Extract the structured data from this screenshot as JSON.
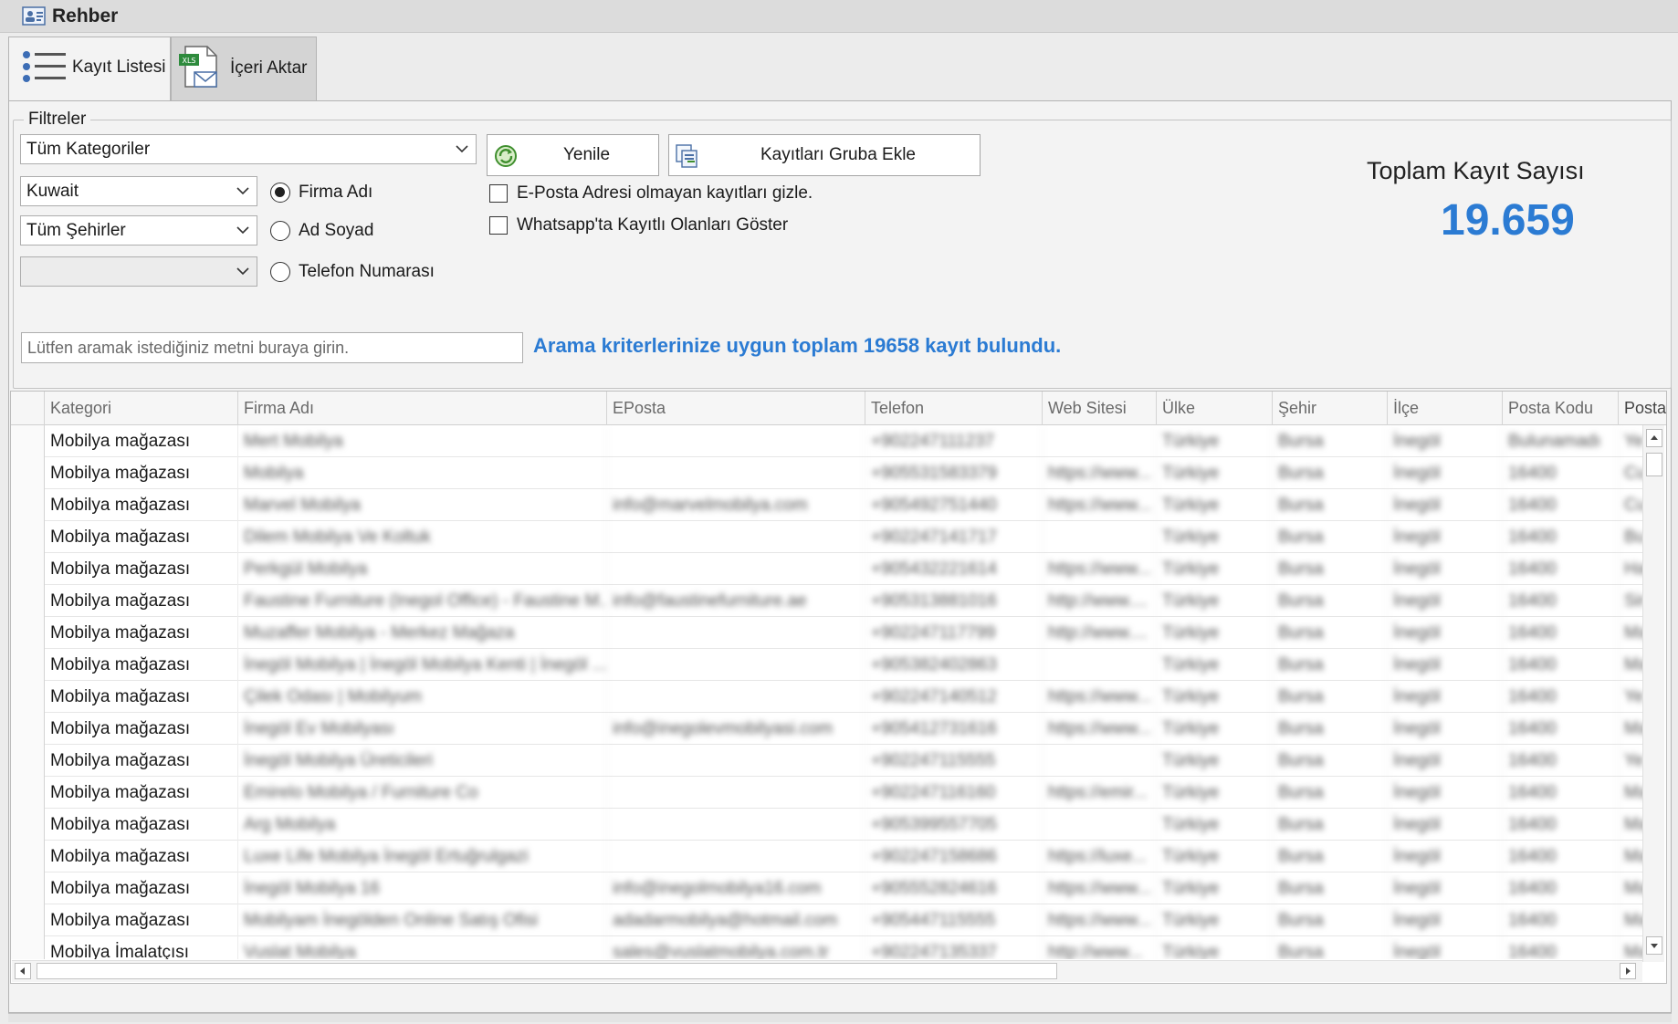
{
  "window": {
    "title": "Rehber"
  },
  "tabs": [
    {
      "label": "Kayıt Listesi",
      "icon": "list-icon",
      "active": true
    },
    {
      "label": "İçeri Aktar",
      "icon": "xls-import-icon",
      "active": false
    }
  ],
  "filters": {
    "legend": "Filtreler",
    "category": "Tüm Kategoriler",
    "country": "Kuwait",
    "city": "Tüm Şehirler",
    "district": "",
    "search_mode": {
      "options": [
        "Firma Adı",
        "Ad Soyad",
        "Telefon Numarası"
      ],
      "selected": "Firma Adı"
    },
    "refresh_label": "Yenile",
    "add_group_label": "Kayıtları Gruba Ekle",
    "hide_no_email_label": "E-Posta Adresi olmayan kayıtları gizle.",
    "show_whatsapp_label": "Whatsapp'ta Kayıtlı Olanları Göster",
    "hide_no_email_checked": false,
    "show_whatsapp_checked": false
  },
  "summary": {
    "total_label": "Toplam Kayıt Sayısı",
    "total_value": "19.659"
  },
  "search": {
    "placeholder": "Lütfen aramak istediğiniz metni buraya girin.",
    "value": ""
  },
  "result_message": "Arama kriterlerinize uygun toplam 19658 kayıt bulundu.",
  "colors": {
    "accent": "#2b7bd3"
  },
  "grid": {
    "columns": [
      "Kategori",
      "Firma Adı",
      "EPosta",
      "Telefon",
      "Web Sitesi",
      "Ülke",
      "Şehir",
      "İlçe",
      "Posta Kodu",
      "Posta"
    ],
    "rows": [
      [
        "Mobilya mağazası",
        "Mert Mobilya",
        "",
        "+902247111237",
        "",
        "Türkiye",
        "Bursa",
        "İnegöl",
        "Bulunamadı",
        "Ye"
      ],
      [
        "Mobilya mağazası",
        "Mobilya",
        "",
        "+905531583379",
        "https://www...",
        "Türkiye",
        "Bursa",
        "İnegöl",
        "16400",
        "Cu"
      ],
      [
        "Mobilya mağazası",
        "Marvel Mobilya",
        "info@marvelmobilya.com",
        "+905492751440",
        "https://www...",
        "Türkiye",
        "Bursa",
        "İnegöl",
        "16400",
        "Cu"
      ],
      [
        "Mobilya mağazası",
        "Dilem Mobilya Ve Koltuk",
        "",
        "+902247141717",
        "",
        "Türkiye",
        "Bursa",
        "İnegöl",
        "16400",
        "Bu"
      ],
      [
        "Mobilya mağazası",
        "Perkgül Mobilya",
        "",
        "+905432221614",
        "https://www...",
        "Türkiye",
        "Bursa",
        "İnegöl",
        "16400",
        "Ha"
      ],
      [
        "Mobilya mağazası",
        "Faustine Furniture (Inegol Office) - Faustine M...",
        "info@faustinefurniture.ae",
        "+905313881016",
        "http://www....",
        "Türkiye",
        "Bursa",
        "İnegöl",
        "16400",
        "Sir"
      ],
      [
        "Mobilya mağazası",
        "Muzaffer Mobilya - Merkez Mağaza",
        "",
        "+902247117799",
        "http://www....",
        "Türkiye",
        "Bursa",
        "İnegöl",
        "16400",
        "Ma"
      ],
      [
        "Mobilya mağazası",
        "İnegöl Mobilya | İnegöl Mobilya Kenti | İnegöl ...",
        "",
        "+905382402863",
        "",
        "Türkiye",
        "Bursa",
        "İnegöl",
        "16400",
        "Ma"
      ],
      [
        "Mobilya mağazası",
        "Çilek Odası | Mobilyum",
        "",
        "+902247140512",
        "https://www...",
        "Türkiye",
        "Bursa",
        "İnegöl",
        "16400",
        "Ye"
      ],
      [
        "Mobilya mağazası",
        "İnegöl Ev Mobilyası",
        "info@inegolevmobilyasi.com",
        "+905412731616",
        "https://www...",
        "Türkiye",
        "Bursa",
        "İnegöl",
        "16400",
        "Ma"
      ],
      [
        "Mobilya mağazası",
        "İnegöl Mobilya Üreticileri",
        "",
        "+902247115555",
        "",
        "Türkiye",
        "Bursa",
        "İnegöl",
        "16400",
        "Ye"
      ],
      [
        "Mobilya mağazası",
        "Emirelo Mobilya / Furniture Co",
        "",
        "+902247116160",
        "https://emir...",
        "Türkiye",
        "Bursa",
        "İnegöl",
        "16400",
        "Ma"
      ],
      [
        "Mobilya mağazası",
        "Arg Mobilya",
        "",
        "+905399557705",
        "",
        "Türkiye",
        "Bursa",
        "İnegöl",
        "16400",
        "Ma"
      ],
      [
        "Mobilya mağazası",
        "Luxe Life Mobilya İnegöl Ertuğrulgazi",
        "",
        "+902247158686",
        "https://luxe...",
        "Türkiye",
        "Bursa",
        "İnegöl",
        "16400",
        "Ma"
      ],
      [
        "Mobilya mağazası",
        "İnegöl Mobilya 16",
        "info@inegolmobilya16.com",
        "+905552824616",
        "https://www...",
        "Türkiye",
        "Bursa",
        "İnegöl",
        "16400",
        "Ma"
      ],
      [
        "Mobilya mağazası",
        "Mobilyam İnegölden Online Satış Ofisi",
        "adadarmobilya@hotmail.com",
        "+905447115555",
        "https://www...",
        "Türkiye",
        "Bursa",
        "İnegöl",
        "16400",
        "Ma"
      ],
      [
        "Mobilya İmalatçısı",
        "Vuslat Mobilya",
        "sales@vuslatmobilya.com.tr",
        "+902247135337",
        "http://www...",
        "Türkiye",
        "Bursa",
        "İnegöl",
        "16400",
        "Ma"
      ]
    ]
  }
}
